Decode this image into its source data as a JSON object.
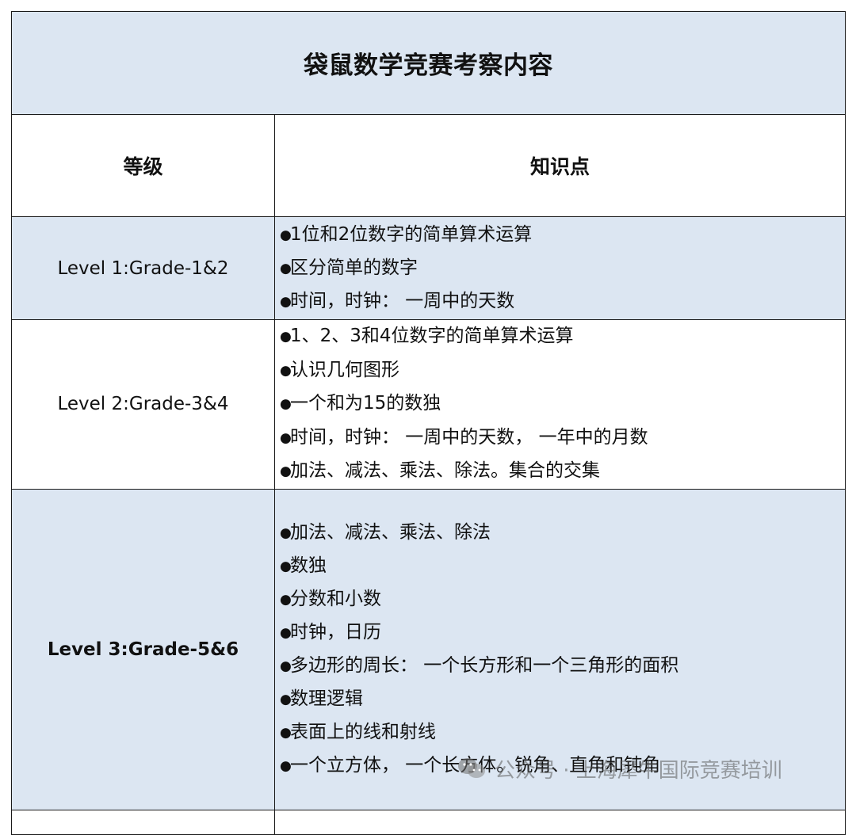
{
  "title": "袋鼠数学竞赛考察内容",
  "headers": {
    "level": "等级",
    "points": "知识点"
  },
  "rows": [
    {
      "level": "Level 1:Grade-1&2",
      "points": [
        "1位和2位数字的简单算术运算",
        "区分简单的数字",
        "时间，时钟： 一周中的天数"
      ]
    },
    {
      "level": "Level 2:Grade-3&4",
      "points": [
        "1、2、3和4位数字的简单算术运算",
        "认识几何图形",
        "一个和为15的数独",
        "时间，时钟： 一周中的天数， 一年中的月数",
        "加法、减法、乘法、除法。集合的交集"
      ]
    },
    {
      "level": "Level 3:Grade-5&6",
      "points": [
        "加法、减法、乘法、除法",
        "数独",
        "分数和小数",
        "时钟，日历",
        "多边形的周长： 一个长方形和一个三角形的面积",
        "数理逻辑",
        "表面上的线和射线",
        "一个立方体， 一个长方体。锐角、直角和钝角"
      ]
    }
  ],
  "bullet": "●",
  "watermark": {
    "icon": "wechat-icon",
    "text": "公众号 · 上海犀牛国际竞赛培训"
  },
  "colors": {
    "header_bg": "#dce6f2",
    "border": "#1a1a1a",
    "watermark": "#8a8a8a"
  }
}
